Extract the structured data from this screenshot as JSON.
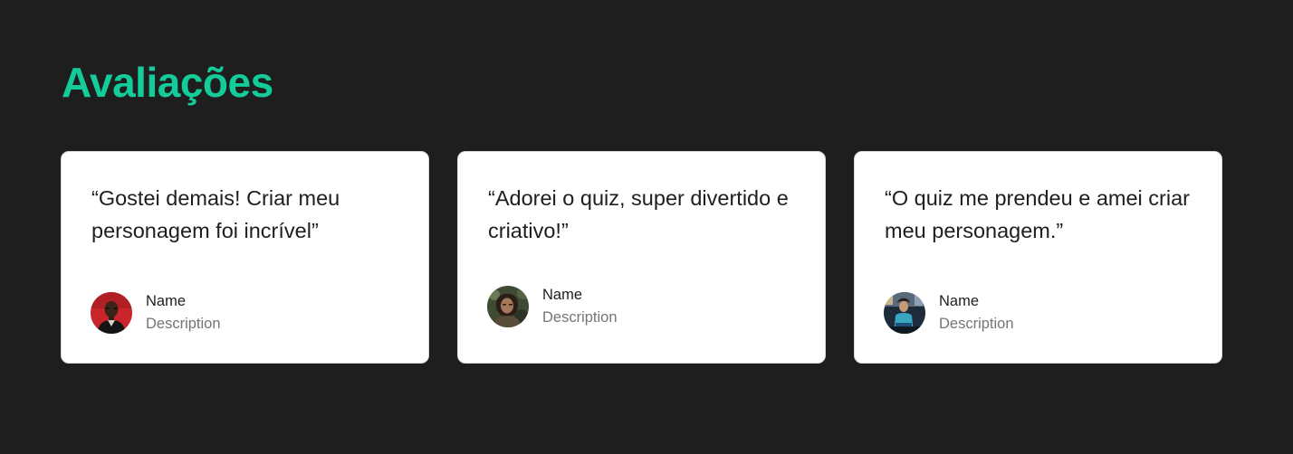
{
  "section": {
    "title": "Avaliações"
  },
  "reviews": [
    {
      "quote": "“Gostei demais! Criar meu personagem foi incrível”",
      "name": "Name",
      "description": "Description",
      "avatar_icon": "person-avatar-red-background"
    },
    {
      "quote": "“Adorei o quiz, super divertido e criativo!”",
      "name": "Name",
      "description": "Description",
      "avatar_icon": "person-avatar-green-background"
    },
    {
      "quote": "“O quiz me prendeu e amei criar meu personagem.”",
      "name": "Name",
      "description": "Description",
      "avatar_icon": "person-avatar-blue-background"
    }
  ],
  "colors": {
    "background": "#1e1e1e",
    "accent": "#14cc9a",
    "card": "#ffffff",
    "text_primary": "#1e1e1e",
    "text_secondary": "#757575"
  }
}
